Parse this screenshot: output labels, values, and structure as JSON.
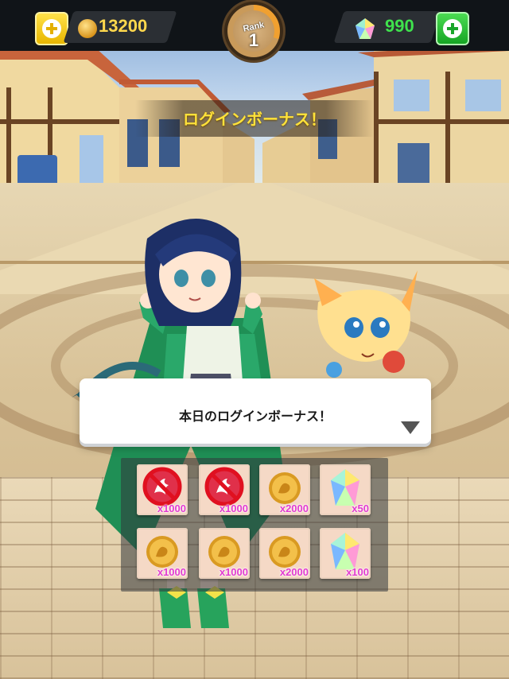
{
  "header": {
    "coins": "13200",
    "gems": "990",
    "rank_label": "Rank",
    "rank_value": "1",
    "coin_icon": "coin-icon",
    "gem_icon": "gem-icon",
    "add_coins_icon": "plus-icon",
    "add_gems_icon": "plus-icon"
  },
  "banner": {
    "title": "ログインボーナス！"
  },
  "dialog": {
    "message": "本日のログインボーナス！",
    "next_icon": "triangle-down-icon"
  },
  "bonus_grid": [
    {
      "icon": "dragon-emblem-icon",
      "quantity": "x1000",
      "claimed": true
    },
    {
      "icon": "dragon-emblem-icon",
      "quantity": "x1000",
      "claimed": true
    },
    {
      "icon": "coin-icon",
      "quantity": "x2000",
      "claimed": false
    },
    {
      "icon": "gem-icon",
      "quantity": "x50",
      "claimed": false
    },
    {
      "icon": "coin-icon",
      "quantity": "x1000",
      "claimed": false
    },
    {
      "icon": "coin-icon",
      "quantity": "x1000",
      "claimed": false
    },
    {
      "icon": "coin-icon",
      "quantity": "x2000",
      "claimed": false
    },
    {
      "icon": "gem-icon",
      "quantity": "x100",
      "claimed": false
    }
  ],
  "colors": {
    "coin_text": "#ffd84d",
    "gem_text": "#3fe24d",
    "banner_text": "#ffe23a",
    "quantity_text": "#e23ad0"
  }
}
